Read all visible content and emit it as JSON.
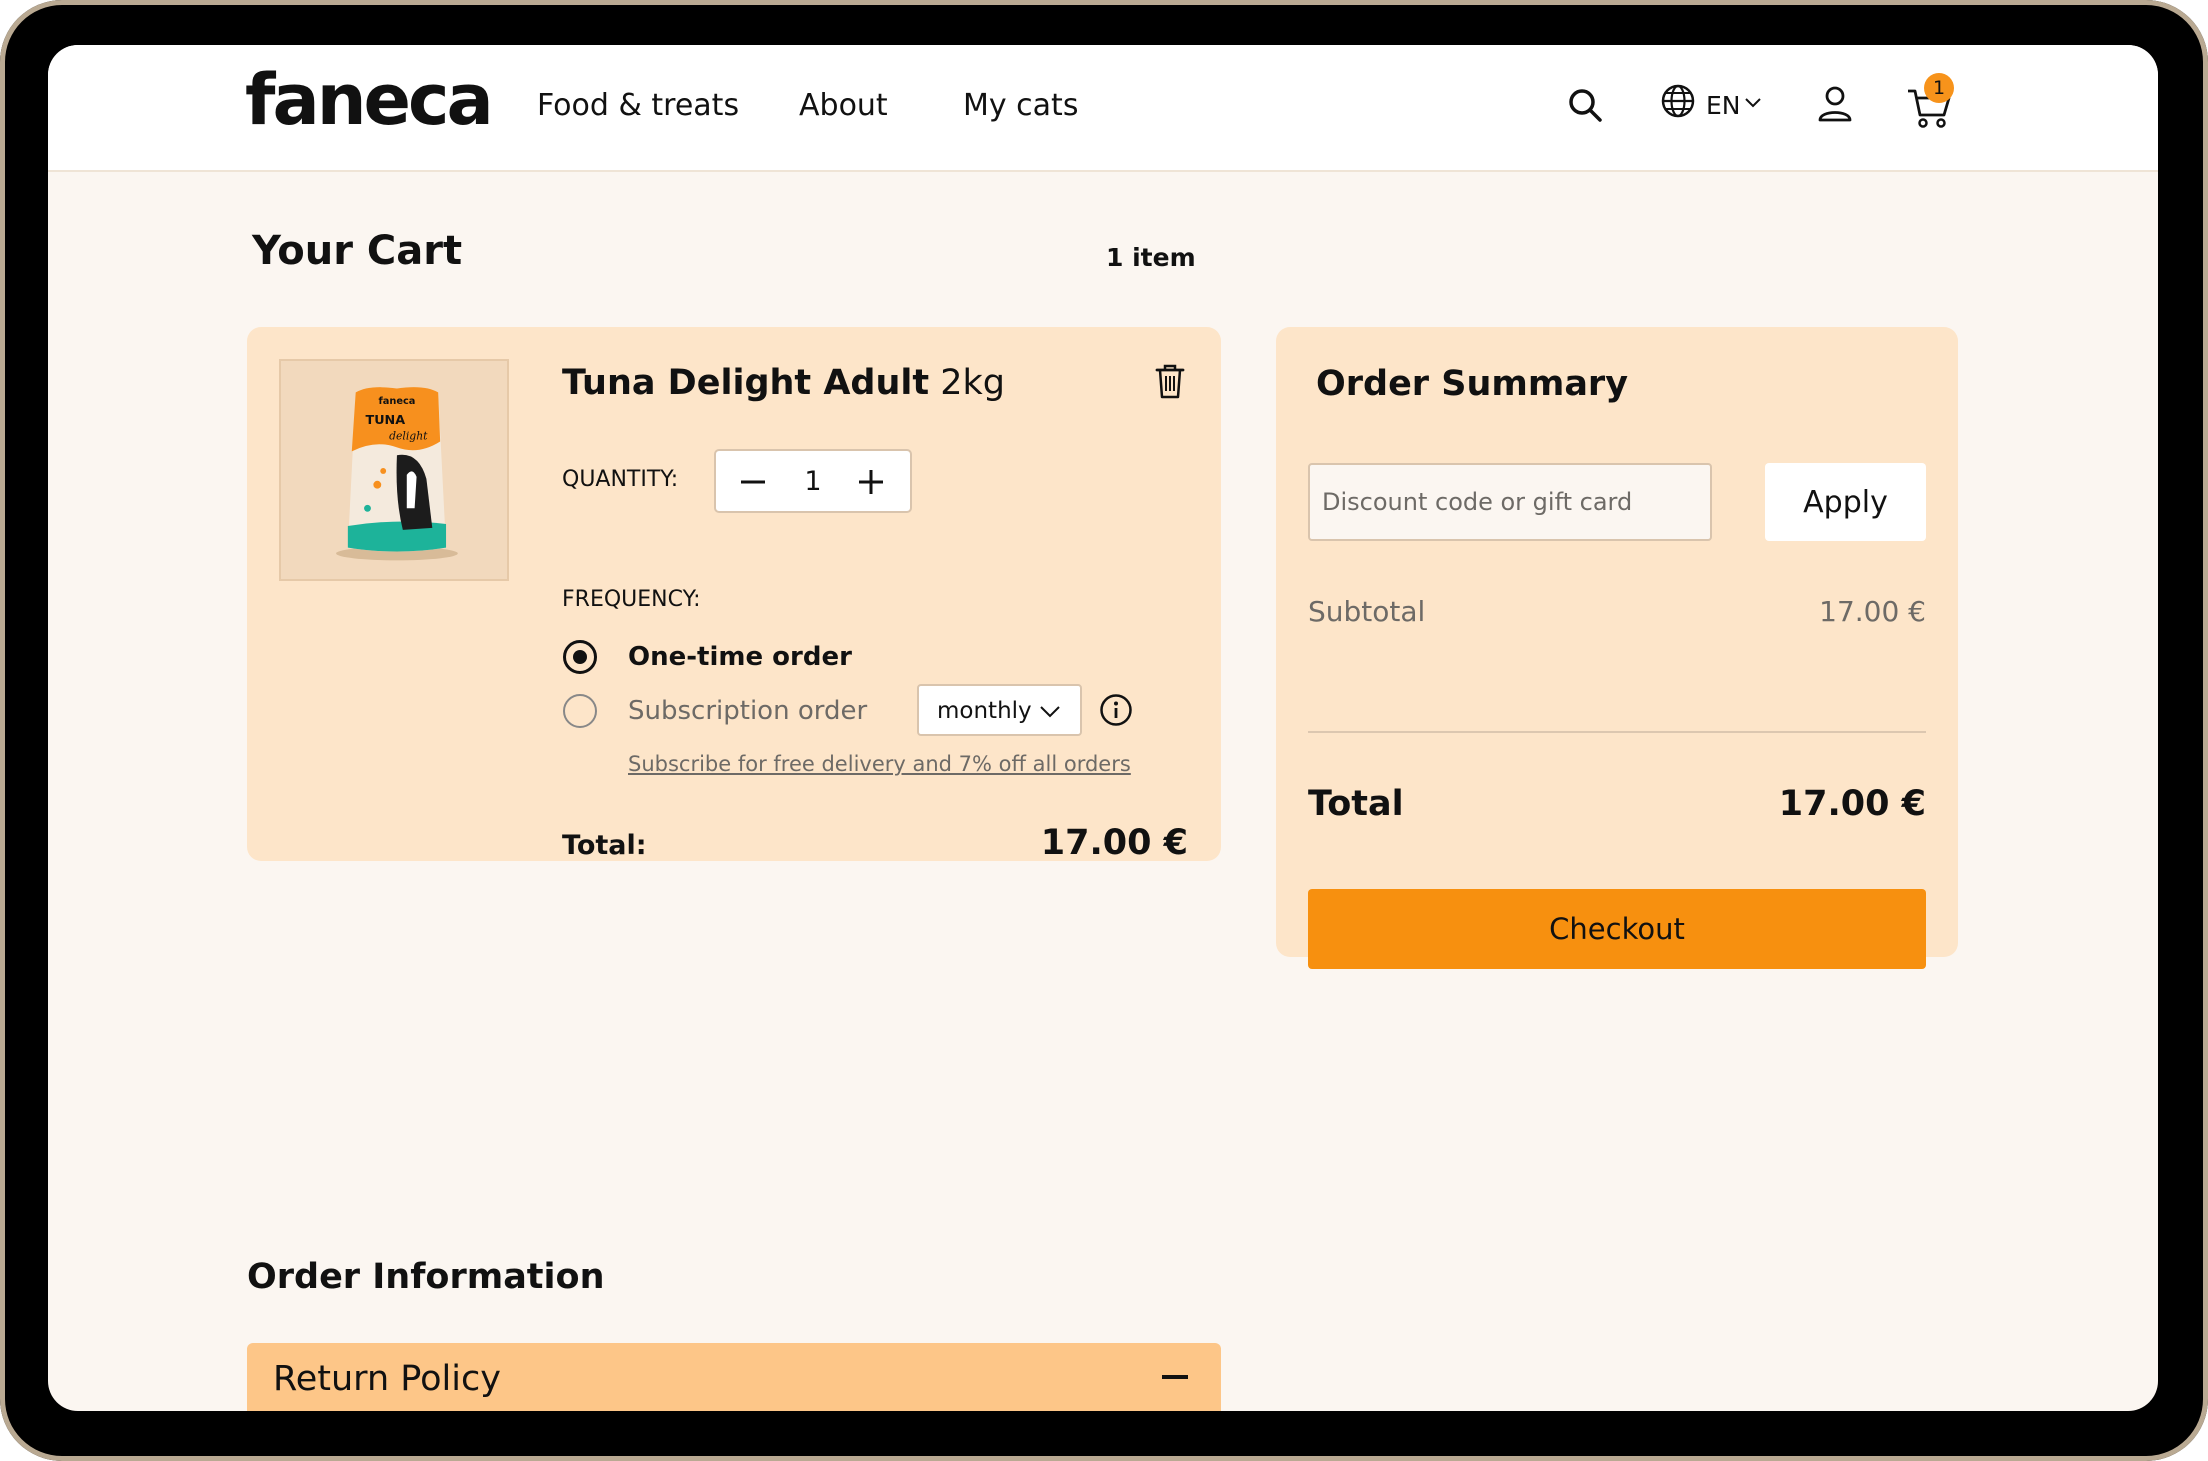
{
  "header": {
    "logo_text": "faneca",
    "nav": {
      "food": "Food & treats",
      "about": "About",
      "cats": "My cats"
    },
    "language": "EN",
    "cart_count": "1"
  },
  "cart": {
    "title": "Your Cart",
    "item_count": "1 item",
    "item": {
      "name": "Tuna Delight Adult",
      "size": "2kg",
      "quantity_label": "QUANTITY:",
      "quantity": "1",
      "frequency_label": "FREQUENCY:",
      "option_one_time": "One-time order",
      "option_subscription": "Subscription order",
      "subscription_frequency": "monthly",
      "subscribe_link": "Subscribe for free delivery and 7% off all orders",
      "total_label": "Total:",
      "total_value": "17.00 €",
      "package_label_brand": "faneca",
      "package_label_name": "TUNA",
      "package_label_sub": "delight"
    }
  },
  "summary": {
    "title": "Order Summary",
    "discount_placeholder": "Discount code or gift card",
    "apply_label": "Apply",
    "subtotal_label": "Subtotal",
    "subtotal_value": "17.00 €",
    "total_label": "Total",
    "total_value": "17.00 €",
    "checkout_label": "Checkout"
  },
  "order_info": {
    "title": "Order Information",
    "return_policy": "Return Policy"
  },
  "colors": {
    "accent": "#f7900f",
    "card": "#fde5c9",
    "accordion": "#fdc688",
    "page": "#fbf6f1"
  }
}
